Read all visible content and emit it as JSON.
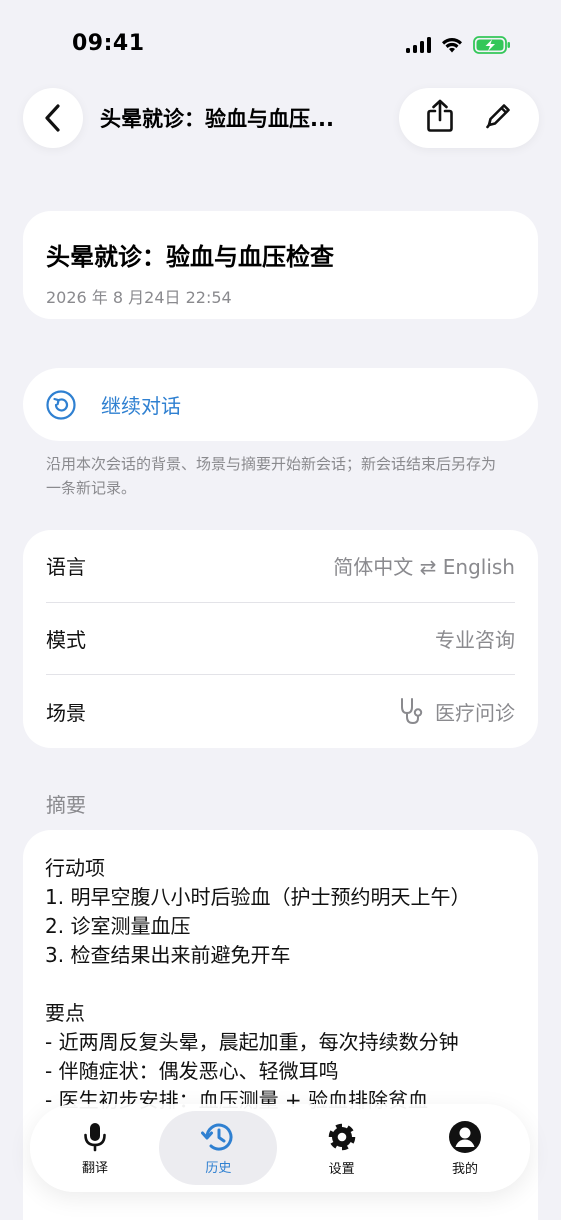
{
  "status_bar": {
    "time": "09:41"
  },
  "header": {
    "title": "头晕就诊：验血与血压...",
    "back_icon": "chevron-left-icon",
    "share_icon": "share-icon",
    "edit_icon": "pencil-icon"
  },
  "record": {
    "title": "头晕就诊：验血与血压检查",
    "date": "2026 年 8 月24日 22:54"
  },
  "continue": {
    "label": "继续对话",
    "note": "沿用本次会话的背景、场景与摘要开始新会话；新会话结束后另存为一条新记录。"
  },
  "settings": {
    "rows": [
      {
        "label": "语言",
        "value": "简体中文 ⇄ English"
      },
      {
        "label": "模式",
        "value": "专业咨询"
      },
      {
        "label": "场景",
        "value": "医疗问诊",
        "icon": "stethoscope-icon"
      }
    ]
  },
  "summary": {
    "section_title": "摘要",
    "action_items_title": "行动项",
    "action_items": [
      "1. 明早空腹八小时后验血（护士预约明天上午）",
      "2. 诊室测量血压",
      "3. 检查结果出来前避免开车"
    ],
    "key_points_title": "要点",
    "key_points": [
      "- 近两周反复头晕，晨起加重，每次持续数分钟",
      "- 伴随症状：偶发恶心、轻微耳鸣",
      "- 医生初步安排：血压测量 + 验血排除贫血"
    ]
  },
  "tab_bar": {
    "tabs": [
      {
        "label": "翻译",
        "icon": "microphone-icon",
        "active": false
      },
      {
        "label": "历史",
        "icon": "history-icon",
        "active": true
      },
      {
        "label": "设置",
        "icon": "gear-icon",
        "active": false
      },
      {
        "label": "我的",
        "icon": "person-icon",
        "active": false
      }
    ]
  },
  "colors": {
    "accent": "#2f80d1",
    "background": "#f2f2f7",
    "battery": "#34c759"
  }
}
